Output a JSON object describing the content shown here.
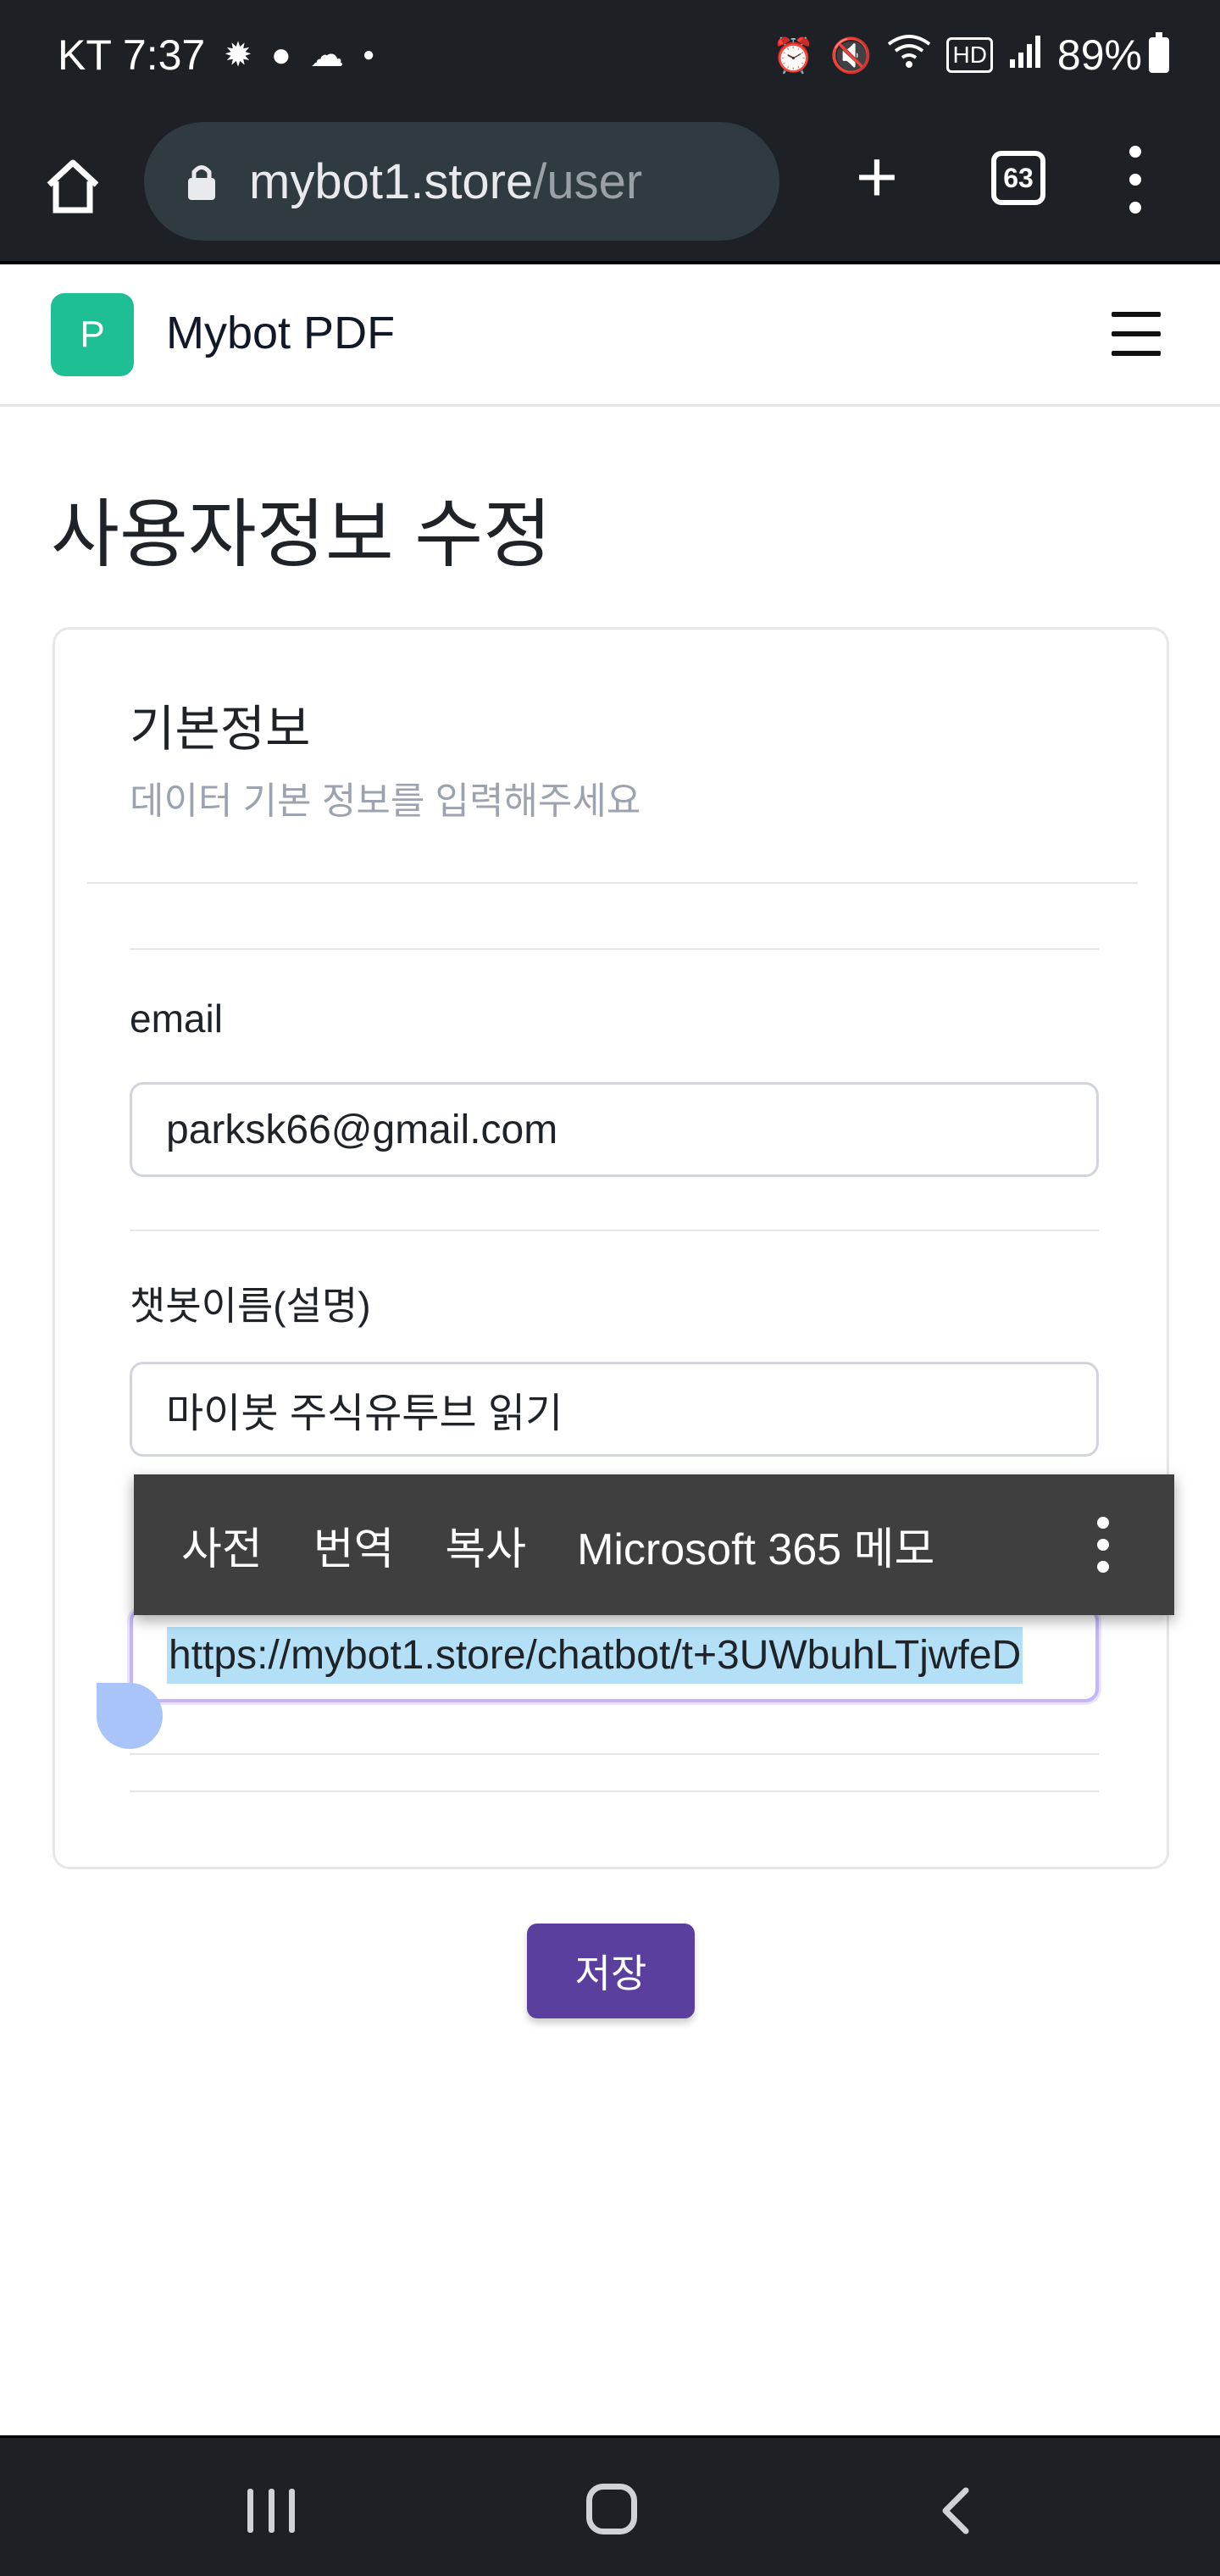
{
  "status_bar": {
    "carrier_time": "KT 7:37",
    "left_icons": [
      "camera-shutter-icon",
      "chat-bubble-icon",
      "cloud-icon",
      "dot-icon"
    ],
    "right_icons": [
      "alarm-icon",
      "mute-icon",
      "wifi-icon",
      "hd-icon",
      "signal-icon"
    ],
    "battery": "89%"
  },
  "browser": {
    "url_host": "mybot1.store",
    "url_path": "/user",
    "tab_count": "63"
  },
  "app": {
    "logo_letter": "P",
    "brand": "Mybot PDF"
  },
  "page": {
    "title": "사용자정보 수정"
  },
  "card": {
    "title": "기본정보",
    "subtitle": "데이터 기본 정보를 입력해주세요",
    "fields": [
      {
        "label": "email",
        "value": "parksk66@gmail.com"
      },
      {
        "label": "챗봇이름(설명)",
        "value": "마이봇 주식유투브 읽기"
      },
      {
        "label": "",
        "value": "https://mybot1.store/chatbot/t+3UWbuhLTjwfeD"
      }
    ]
  },
  "context_menu": {
    "items": [
      "사전",
      "번역",
      "복사",
      "Microsoft 365 메모"
    ]
  },
  "save_button": "저장",
  "colors": {
    "brand_green": "#1fbf94",
    "primary_purple": "#5b3f9e",
    "selection": "#b3e0f7",
    "handle": "#a8c4f8",
    "system_bar": "#1d2025"
  }
}
